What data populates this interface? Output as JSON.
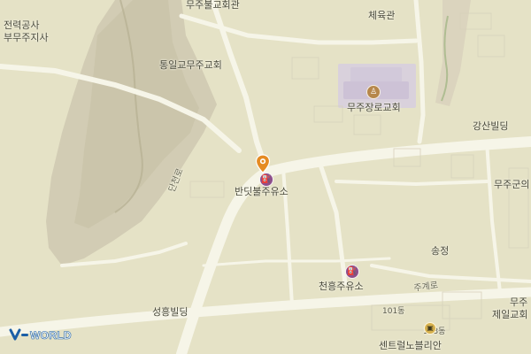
{
  "map": {
    "watermark": "V-WORLD",
    "colors": {
      "background": "#e5e2c6",
      "road": "#f6f5e8",
      "mountain": "#cfcab2",
      "campus": "#d8d1df",
      "pin": "#e58b23",
      "gas": "#8d4f8a",
      "church": "#b6874b"
    }
  },
  "labels": {
    "top_left_1": "전력공사",
    "top_left_2": "부무주지사",
    "church_top": "무주불교회관",
    "sports_hall": "체육관",
    "unified_church": "통일교무주교회",
    "longchurch": "무주장로교회",
    "gangsan": "강산빌딩",
    "main_station": "반딧불주유소",
    "danchul": "단천로",
    "muju_right": "무주군의",
    "songjeong": "송정",
    "cheonheung": "천흥주유소",
    "jugyero": "주계로",
    "seongheung": "성흥빌딩",
    "muju_bottom": "무주",
    "jeil": "제일교회",
    "bldg_101": "101동",
    "bldg_103": "103동",
    "central_nobel": "센트럴노블리안"
  },
  "icons": {
    "marker": "location-pin-icon",
    "gas": "gas-station-icon",
    "church": "church-icon",
    "apartment": "apartment-icon"
  }
}
